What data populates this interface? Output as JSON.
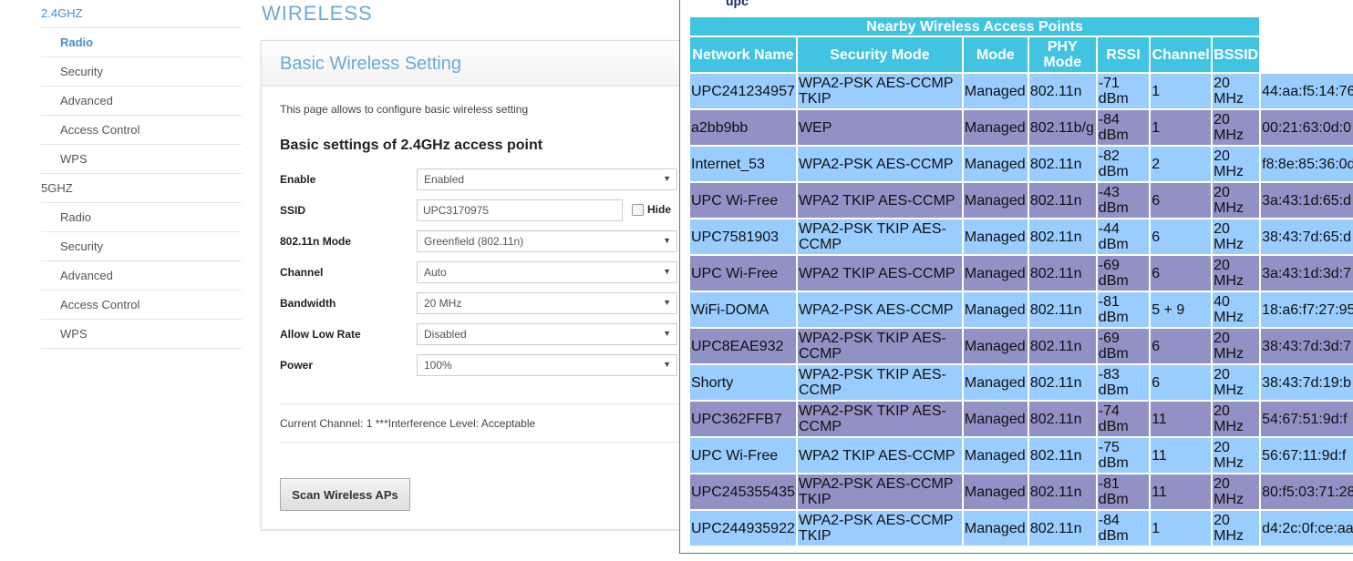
{
  "sidebar": {
    "group_24": "2.4GHZ",
    "items_24": [
      "Radio",
      "Security",
      "Advanced",
      "Access Control",
      "WPS"
    ],
    "group_5": "5GHZ",
    "items_5": [
      "Radio",
      "Security",
      "Advanced",
      "Access Control",
      "WPS"
    ]
  },
  "page_title": "WIRELESS",
  "panel": {
    "title": "Basic Wireless Setting",
    "description": "This page allows to configure basic wireless setting",
    "subtitle": "Basic settings of 2.4GHz access point",
    "fields": {
      "enable": {
        "label": "Enable",
        "value": "Enabled"
      },
      "ssid": {
        "label": "SSID",
        "value": "UPC3170975",
        "hide_label": "Hide",
        "hide_checked": false
      },
      "mode": {
        "label": "802.11n Mode",
        "value": "Greenfield (802.11n)"
      },
      "channel": {
        "label": "Channel",
        "value": "Auto"
      },
      "bandwidth": {
        "label": "Bandwidth",
        "value": "20 MHz"
      },
      "low_rate": {
        "label": "Allow Low Rate",
        "value": "Disabled"
      },
      "power": {
        "label": "Power",
        "value": "100%"
      }
    },
    "current_channel": "Current Channel: 1 ***Interference Level: Acceptable",
    "scan_button": "Scan Wireless APs"
  },
  "popup": {
    "logo": "upc",
    "table_title": "Nearby Wireless Access Points",
    "headers": [
      "Network Name",
      "Security Mode",
      "Mode",
      "PHY Mode",
      "RSSI",
      "Channel",
      "BSSID"
    ],
    "rows": [
      [
        "UPC241234957",
        "WPA2-PSK AES-CCMP TKIP",
        "Managed",
        "802.11n",
        "-71 dBm",
        "1",
        "20 MHz",
        "44:aa:f5:14:76"
      ],
      [
        "a2bb9bb",
        "WEP",
        "Managed",
        "802.11b/g",
        "-84 dBm",
        "1",
        "20 MHz",
        "00:21:63:0d:0"
      ],
      [
        "Internet_53",
        "WPA2-PSK AES-CCMP",
        "Managed",
        "802.11n",
        "-82 dBm",
        "2",
        "20 MHz",
        "f8:8e:85:36:0d"
      ],
      [
        "UPC Wi-Free",
        "WPA2 TKIP AES-CCMP",
        "Managed",
        "802.11n",
        "-43 dBm",
        "6",
        "20 MHz",
        "3a:43:1d:65:d"
      ],
      [
        "UPC7581903",
        "WPA2-PSK TKIP AES-CCMP",
        "Managed",
        "802.11n",
        "-44 dBm",
        "6",
        "20 MHz",
        "38:43:7d:65:d"
      ],
      [
        "UPC Wi-Free",
        "WPA2 TKIP AES-CCMP",
        "Managed",
        "802.11n",
        "-69 dBm",
        "6",
        "20 MHz",
        "3a:43:1d:3d:7"
      ],
      [
        "WiFi-DOMA",
        "WPA2-PSK AES-CCMP",
        "Managed",
        "802.11n",
        "-81 dBm",
        "5 + 9",
        "40 MHz",
        "18:a6:f7:27:95"
      ],
      [
        "UPC8EAE932",
        "WPA2-PSK TKIP AES-CCMP",
        "Managed",
        "802.11n",
        "-69 dBm",
        "6",
        "20 MHz",
        "38:43:7d:3d:7"
      ],
      [
        "Shorty",
        "WPA2-PSK TKIP AES-CCMP",
        "Managed",
        "802.11n",
        "-83 dBm",
        "6",
        "20 MHz",
        "38:43:7d:19:b"
      ],
      [
        "UPC362FFB7",
        "WPA2-PSK TKIP AES-CCMP",
        "Managed",
        "802.11n",
        "-74 dBm",
        "11",
        "20 MHz",
        "54:67:51:9d:f"
      ],
      [
        "UPC Wi-Free",
        "WPA2 TKIP AES-CCMP",
        "Managed",
        "802.11n",
        "-75 dBm",
        "11",
        "20 MHz",
        "56:67:11:9d:f"
      ],
      [
        "UPC245355435",
        "WPA2-PSK AES-CCMP TKIP",
        "Managed",
        "802.11n",
        "-81 dBm",
        "11",
        "20 MHz",
        "80:f5:03:71:28"
      ],
      [
        "UPC244935922",
        "WPA2-PSK AES-CCMP TKIP",
        "Managed",
        "802.11n",
        "-84 dBm",
        "1",
        "20 MHz",
        "d4:2c:0f:ce:aa"
      ]
    ]
  },
  "colors": {
    "header": "#41c3e2",
    "row_odd": "#99ccff",
    "row_even": "#9191c6",
    "accent": "#6aaad6"
  }
}
